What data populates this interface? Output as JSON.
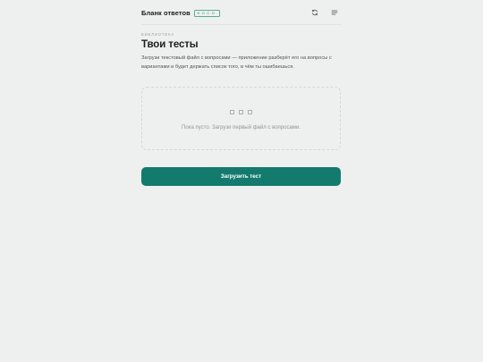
{
  "header": {
    "title": "Бланк ответов",
    "badge": "косо",
    "icons": {
      "sync": "sync-icon",
      "menu": "menu-icon"
    }
  },
  "library": {
    "section_label": "Библиотека",
    "title": "Твои тесты",
    "description": "Загрузи текстовый файл с вопросами — приложение разберёт его на вопросы с вариантами и будет держать список того, в чём ты ошибаешься."
  },
  "empty_state": {
    "icon": "empty-squares-icon",
    "message": "Пока пусто. Загрузи первый файл с вопросами."
  },
  "actions": {
    "upload_label": "Загрузить тест"
  },
  "colors": {
    "accent": "#137b6d",
    "badge": "#2f8a76",
    "background": "#eef0ef"
  }
}
